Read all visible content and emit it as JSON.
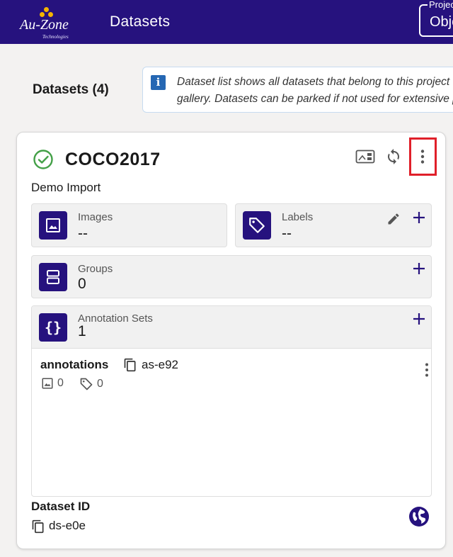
{
  "header": {
    "logo_text": "Au-Zone",
    "logo_subtext": "Technologies",
    "nav_title": "Datasets",
    "project_label": "Project",
    "project_value": "Object"
  },
  "page": {
    "heading": "Datasets (4)",
    "info_line1": "Dataset list shows all datasets that belong to this project",
    "info_line2": "gallery. Datasets can be parked if not used for extensive periods"
  },
  "dataset": {
    "status_icon": "check-circle-icon",
    "name": "COCO2017",
    "subtitle": "Demo Import",
    "images": {
      "label": "Images",
      "value": "--"
    },
    "labels": {
      "label": "Labels",
      "value": "--"
    },
    "groups": {
      "label": "Groups",
      "value": "0"
    },
    "annotation_sets": {
      "label": "Annotation Sets",
      "value": "1",
      "items": [
        {
          "name": "annotations",
          "id": "as-e92",
          "images": "0",
          "labels": "0"
        }
      ]
    },
    "id_label": "Dataset ID",
    "id_value": "ds-e0e"
  },
  "colors": {
    "brand": "#26127e",
    "success": "#43a047",
    "highlight": "#e0202a",
    "info": "#2567b3"
  }
}
